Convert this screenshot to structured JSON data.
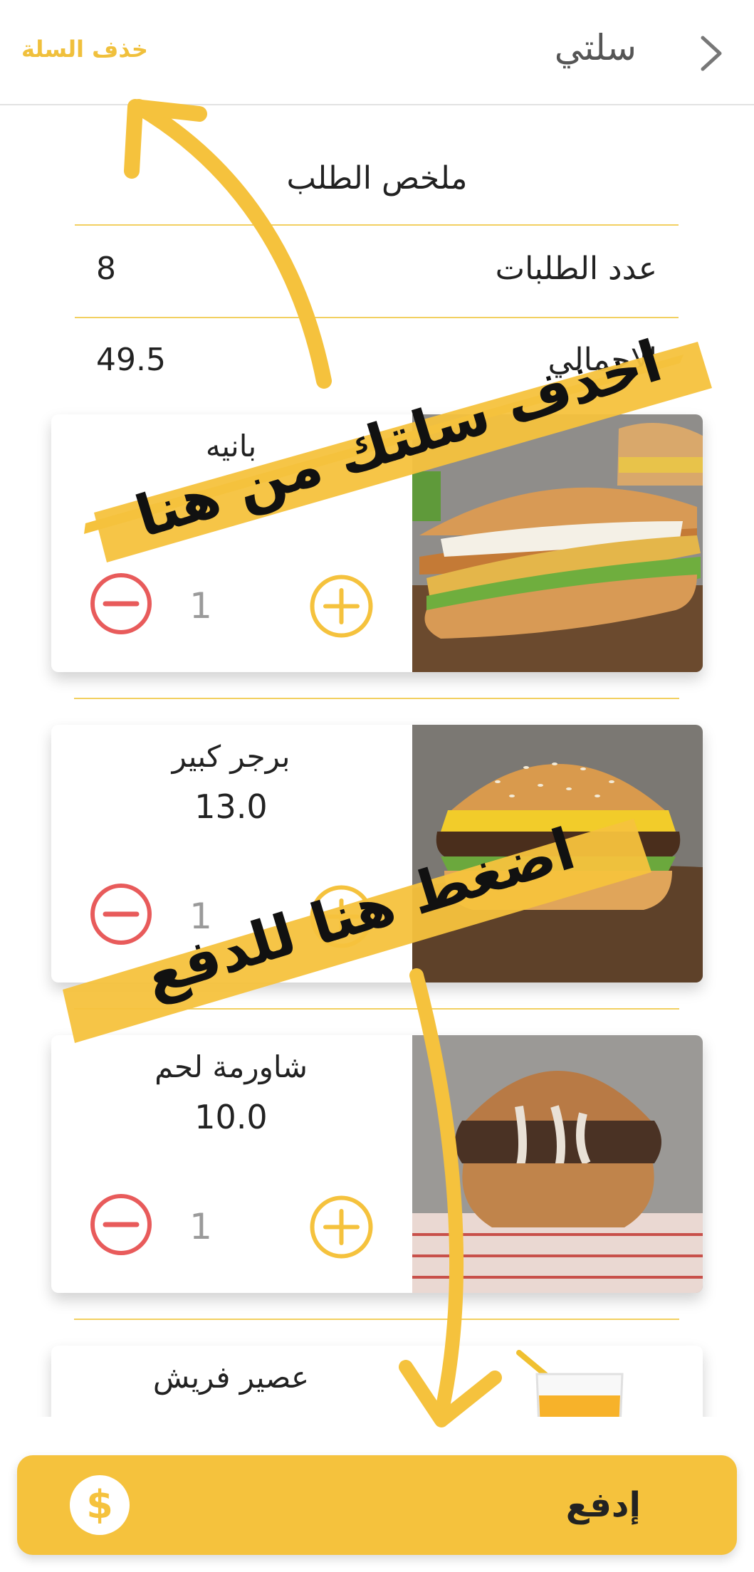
{
  "header": {
    "title": "سلتي",
    "clear_label": "خذف السلة"
  },
  "summary": {
    "title": "ملخص الطلب",
    "rows": [
      {
        "label": "عدد الطلبات",
        "value": "8"
      },
      {
        "label": "الاجمالي",
        "value": "49.5"
      }
    ]
  },
  "cart": {
    "items": [
      {
        "name": "بانيه",
        "price": "",
        "qty": "1",
        "image": "chicken-sandwich"
      },
      {
        "name": "برجر كبير",
        "price": "13.0",
        "qty": "1",
        "image": "burger"
      },
      {
        "name": "شاورمة لحم",
        "price": "10.0",
        "qty": "1",
        "image": "shawarma-bun"
      },
      {
        "name": "عصير فريش",
        "price": "",
        "qty": "",
        "image": "orange-juice"
      }
    ]
  },
  "annotations": {
    "clear_hint": "اخذف سلتك من هنا",
    "pay_hint": "اضغط هنا للدفع",
    "highlight_color": "#f5c23d"
  },
  "pay": {
    "label": "إدفع",
    "icon": "dollar-icon"
  },
  "colors": {
    "accent": "#f5c23d",
    "minus": "#e85b5b",
    "divider": "#f2d061"
  }
}
